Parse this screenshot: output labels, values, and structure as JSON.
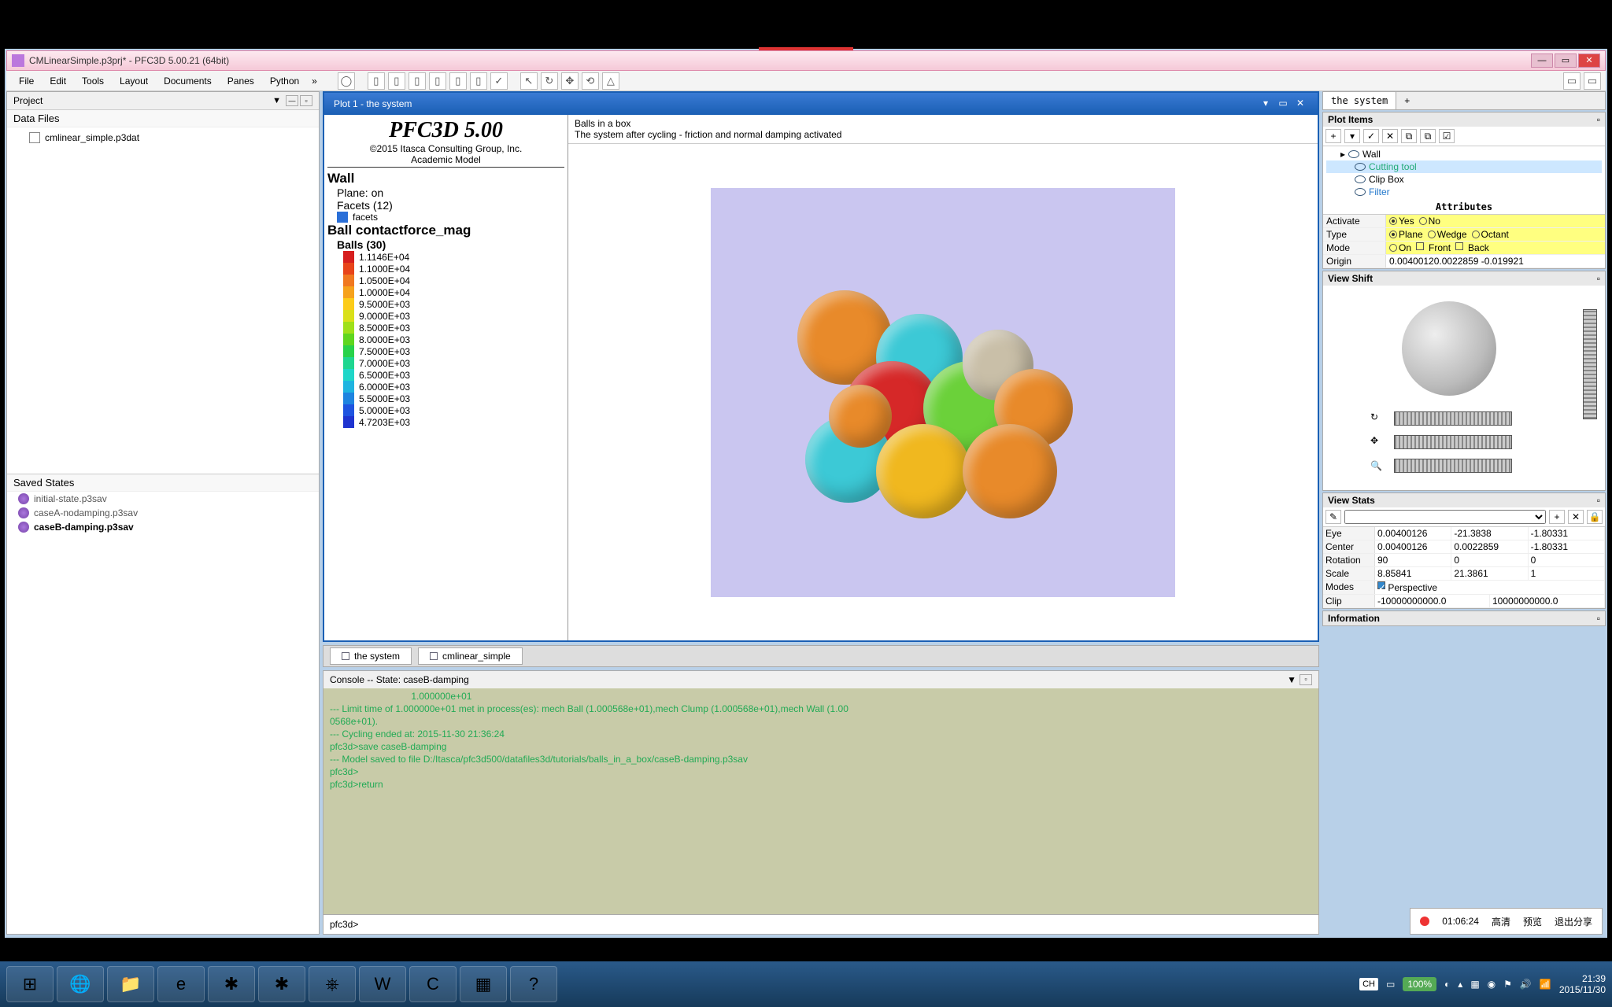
{
  "window_title": "CMLinearSimple.p3prj* - PFC3D 5.00.21 (64bit)",
  "menu": [
    "File",
    "Edit",
    "Tools",
    "Layout",
    "Documents",
    "Panes",
    "Python"
  ],
  "project": {
    "title": "Project",
    "data_files_label": "Data Files",
    "files": [
      "cmlinear_simple.p3dat"
    ],
    "saved_states_label": "Saved States",
    "states": [
      "initial-state.p3sav",
      "caseA-nodamping.p3sav",
      "caseB-damping.p3sav"
    ]
  },
  "plot": {
    "title": "Plot 1 - the system",
    "product": "PFC3D 5.00",
    "copyright": "©2015 Itasca Consulting Group, Inc.",
    "academic": "Academic Model",
    "wall_label": "Wall",
    "wall_plane": "Plane: on",
    "wall_facets": "Facets (12)",
    "wall_facets_item": "facets",
    "ball_label": "Ball contactforce_mag",
    "balls_count": "Balls (30)",
    "caption_title": "Balls in a box",
    "caption_sub": "The system after cycling - friction and normal damping activated",
    "legend": [
      {
        "c": "#d61f1f",
        "v": "1.1146E+04"
      },
      {
        "c": "#e8441a",
        "v": "1.1000E+04"
      },
      {
        "c": "#f07820",
        "v": "1.0500E+04"
      },
      {
        "c": "#f6a21c",
        "v": "1.0000E+04"
      },
      {
        "c": "#fccc1a",
        "v": "9.5000E+03"
      },
      {
        "c": "#d9e01a",
        "v": "9.0000E+03"
      },
      {
        "c": "#9fe01a",
        "v": "8.5000E+03"
      },
      {
        "c": "#5fd61f",
        "v": "8.0000E+03"
      },
      {
        "c": "#28d24a",
        "v": "7.5000E+03"
      },
      {
        "c": "#1fd690",
        "v": "7.0000E+03"
      },
      {
        "c": "#1fd6c8",
        "v": "6.5000E+03"
      },
      {
        "c": "#1fb4e0",
        "v": "6.0000E+03"
      },
      {
        "c": "#1f84e0",
        "v": "5.5000E+03"
      },
      {
        "c": "#1f54e0",
        "v": "5.0000E+03"
      },
      {
        "c": "#1f34d0",
        "v": "4.7203E+03"
      }
    ]
  },
  "bottom_tabs": [
    "the system",
    "cmlinear_simple"
  ],
  "console": {
    "title": "Console -- State: caseB-damping",
    "lines": "                               1.000000e+01\n--- Limit time of 1.000000e+01 met in process(es): mech Ball (1.000568e+01),mech Clump (1.000568e+01),mech Wall (1.00\n0568e+01).\n--- Cycling ended at: 2015-11-30 21:36:24\npfc3d>save caseB-damping\n--- Model saved to file D:/Itasca/pfc3d500/datafiles3d/tutorials/balls_in_a_box/caseB-damping.p3sav\npfc3d>\npfc3d>return",
    "prompt": "pfc3d>"
  },
  "right": {
    "tab": "the system",
    "plot_items_label": "Plot Items",
    "tree": {
      "wall": "Wall",
      "cutting": "Cutting tool",
      "clip": "Clip Box",
      "filter": "Filter"
    },
    "attributes_label": "Attributes",
    "attrs": {
      "activate_label": "Activate",
      "activate_yes": "Yes",
      "activate_no": "No",
      "type_label": "Type",
      "type_plane": "Plane",
      "type_wedge": "Wedge",
      "type_octant": "Octant",
      "mode_label": "Mode",
      "mode_on": "On",
      "mode_front": "Front",
      "mode_back": "Back",
      "origin_label": "Origin",
      "origin_val": "0.00400120.0022859 -0.019921"
    },
    "view_shift_label": "View Shift",
    "view_stats_label": "View Stats",
    "stats": {
      "eye_label": "Eye",
      "eye": [
        "0.00400126",
        "-21.3838",
        "-1.80331"
      ],
      "center_label": "Center",
      "center": [
        "0.00400126",
        "0.0022859",
        "-1.80331"
      ],
      "rotation_label": "Rotation",
      "rotation": [
        "90",
        "0",
        "0"
      ],
      "scale_label": "Scale",
      "scale": [
        "8.85841",
        "21.3861",
        "1"
      ],
      "modes_label": "Modes",
      "modes_val": "Perspective",
      "clip_label": "Clip",
      "clip": [
        "-10000000000.0",
        "10000000000.0"
      ]
    },
    "information_label": "Information"
  },
  "recording": {
    "time": "01:06:24",
    "buttons": [
      "高清",
      "预览",
      "退出分享"
    ]
  },
  "taskbar": {
    "lang": "CH",
    "zoom": "100%",
    "time": "21:39",
    "date": "2015/11/30"
  }
}
